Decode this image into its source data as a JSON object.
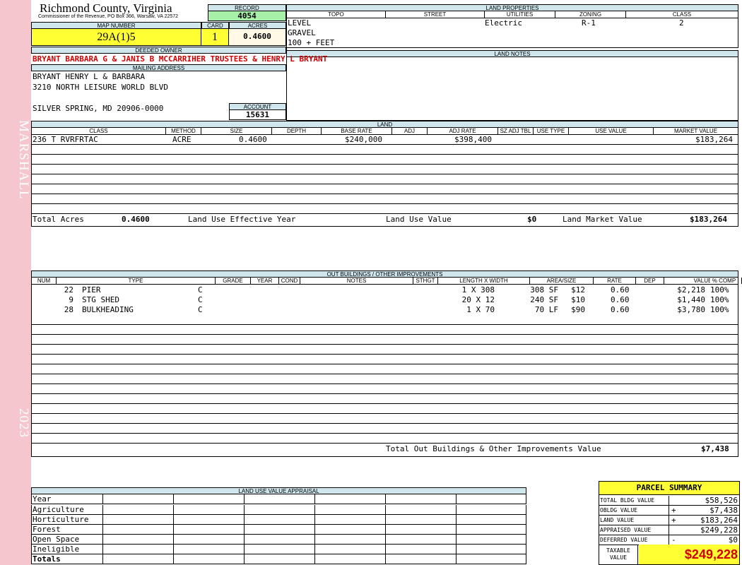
{
  "sidebar": {
    "district": "MARSHALL",
    "year": "2023"
  },
  "county": {
    "name": "Richmond County, Virginia",
    "address": "Commissioner of the Revenue, PO Box 366, Warsaw, VA 22572"
  },
  "record": {
    "label": "RECORD",
    "value": "4054"
  },
  "map": {
    "label": "MAP NUMBER",
    "value": "29A(1)5"
  },
  "card": {
    "label": "CARD",
    "value": "1"
  },
  "acres": {
    "label": "ACRES",
    "value": "0.4600"
  },
  "land_properties": {
    "label": "LAND PROPERTIES",
    "headers": {
      "topo": "TOPO",
      "street": "STREET",
      "utilities": "UTILITIES",
      "zoning": "ZONING",
      "class": "CLASS"
    },
    "topo": [
      "LEVEL",
      "GRAVEL",
      "100 + FEET"
    ],
    "utilities": "Electric",
    "zoning": "R-1",
    "class": "2"
  },
  "deeded_owner": {
    "label": "DEEDED OWNER",
    "value": "BRYANT BARBARA G & JANIS B MCCARRIHER TRUSTEES & HENRY L BRYANT"
  },
  "mailing": {
    "label": "MAILING ADDRESS",
    "line1": "BRYANT HENRY L & BARBARA",
    "line2": "3210 NORTH LEISURE WORLD BLVD",
    "line3": "SILVER SPRING, MD 20906-0000"
  },
  "account": {
    "label": "ACCOUNT",
    "value": "15631"
  },
  "land_notes": {
    "label": "LAND NOTES"
  },
  "land": {
    "label": "LAND",
    "headers": {
      "class": "CLASS",
      "method": "METHOD",
      "size": "SIZE",
      "depth": "DEPTH",
      "base_rate": "BASE RATE",
      "adj": "ADJ",
      "adj_rate": "ADJ RATE",
      "sz_adj_tbl": "SZ ADJ TBL",
      "use_type": "USE TYPE",
      "use_value": "USE VALUE",
      "market_value": "MARKET VALUE"
    },
    "row": {
      "class": "236 T RVRFRTAC",
      "method": "ACRE",
      "size": "0.4600",
      "base_rate": "$240,000",
      "adj_rate": "$398,400",
      "market_value": "$183,264"
    },
    "total_acres_label": "Total Acres",
    "total_acres": "0.4600",
    "effective_year_label": "Land Use Effective Year",
    "use_value_label": "Land Use Value",
    "use_value": "$0",
    "market_value_label": "Land Market Value",
    "market_value": "$183,264"
  },
  "outbuildings": {
    "label": "OUT BUILDINGS / OTHER IMPROVEMENTS",
    "headers": {
      "num": "NUM",
      "type": "TYPE",
      "grade": "GRADE",
      "year": "YEAR",
      "cond": "COND",
      "notes": "NOTES",
      "sthgt": "STHGT",
      "length": "LENGTH X WIDTH",
      "area": "AREA/SIZE",
      "rate": "RATE",
      "dep": "DEP",
      "value": "VALUE",
      "comp": "% COMP"
    },
    "rows": [
      {
        "num": "22",
        "type": "PIER",
        "grade": "C",
        "length": "1 X 308",
        "area": "308 SF",
        "rate": "$12",
        "dep": "0.60",
        "value": "$2,218",
        "comp": "100%"
      },
      {
        "num": "9",
        "type": "STG SHED",
        "grade": "C",
        "length": "20 X 12",
        "area": "240 SF",
        "rate": "$10",
        "dep": "0.60",
        "value": "$1,440",
        "comp": "100%"
      },
      {
        "num": "28",
        "type": "BULKHEADING",
        "grade": "C",
        "length": "1 X 70",
        "area": "70 LF",
        "rate": "$90",
        "dep": "0.60",
        "value": "$3,780",
        "comp": "100%"
      }
    ],
    "total_label": "Total Out Buildings & Other Improvements Value",
    "total": "$7,438"
  },
  "land_use_appraisal": {
    "label": "LAND USE VALUE APPRAISAL",
    "rows": [
      "Year",
      "Agriculture",
      "Horticulture",
      "Forest",
      "Open Space",
      "Ineligible",
      "Totals"
    ]
  },
  "parcel_summary": {
    "title": "PARCEL SUMMARY",
    "rows": [
      {
        "label": "TOTAL BLDG VALUE",
        "op": "",
        "value": "$58,526"
      },
      {
        "label": "OBLDG VALUE",
        "op": "+",
        "value": "$7,438"
      },
      {
        "label": "LAND VALUE",
        "op": "+",
        "value": "$183,264"
      },
      {
        "label": "APPRAISED VALUE",
        "op": "",
        "value": "$249,228"
      },
      {
        "label": "DEFERRED VALUE",
        "op": "-",
        "value": "$0"
      }
    ],
    "taxable_label_1": "TAXABLE",
    "taxable_label_2": "VALUE",
    "taxable_value": "$249,228"
  }
}
